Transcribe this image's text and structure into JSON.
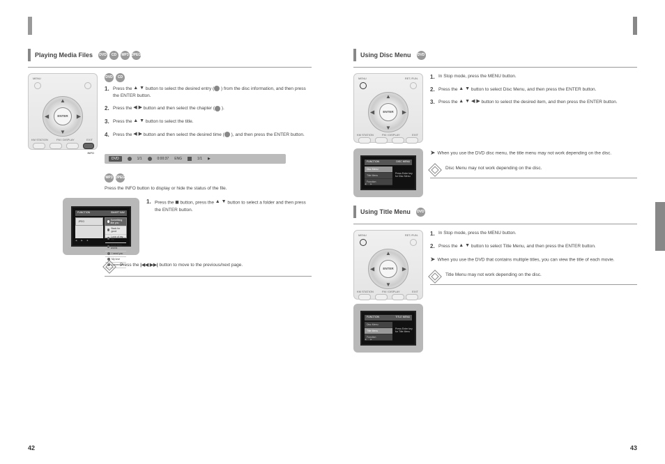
{
  "page_left_num": "42",
  "page_right_num": "43",
  "sec1": {
    "title": "Playing Media Files",
    "icon_row": [
      "DVD",
      "CD",
      "MP3",
      "JPEG"
    ],
    "sub1_icons": [
      "DVD",
      "CD"
    ],
    "sub1_steps": {
      "s1a": "Press the ",
      "s1b": " button to select the desired entry (",
      "s1c": ") from the disc information, and then press the ENTER button.",
      "s2a": "Press the ",
      "s2b": " button and then select the chapter (",
      "s2c": ").",
      "s3a": "Press the ",
      "s3b": " button to select the title.",
      "s4a": "Press the ",
      "s4b": " button and then select the desired time (",
      "s4c": "), and then press the ENTER button."
    },
    "info_bar": {
      "label_dvd": "DVD",
      "label_chapter": "1/1",
      "label_time": "0:00:37",
      "label_eng": "ENG",
      "label_dolby": "1/1"
    },
    "sub2_icons": [
      "MP3",
      "JPEG"
    ],
    "sub2_intro": "Press the INFO button to display or hide the status of the file.",
    "sub2_step1": "Press the ",
    "sub2_step1b": " button, press the ",
    "sub2_step1c": " button to select a folder and then press the ENTER button.",
    "screen1": {
      "top_l": "FUNCTION",
      "top_r": "SMART NAV",
      "side": "JPEG",
      "items": [
        "Something like you",
        "Back for good",
        "Love of my life",
        "More than words",
        "I need you",
        "My love",
        "Uptown girl"
      ]
    },
    "note1a": "Press the ",
    "note1b": " button to move to the previous/next page.",
    "skip_glyphs": "|◀◀ ▶▶|"
  },
  "sec2": {
    "title": "Using Disc Menu",
    "icons": [
      "DVD"
    ],
    "steps": {
      "s1": "In Stop mode, press the MENU button.",
      "s2a": "Press the ",
      "s2b": " button to select Disc Menu, and then press the ENTER button.",
      "s3a": "Press the ",
      "s3b": " button to select the desired item, and then press the ENTER button."
    },
    "tip": "When you use the DVD disc menu, the title menu may not work depending on the disc.",
    "note": "Disc Menu may not work depending on the disc.",
    "screen": {
      "top_l": "FUNCTION",
      "top_r": "DISC MENU",
      "panel": [
        "Disc Menu",
        "Title Menu",
        "Function"
      ],
      "msg1": "Press Enter key",
      "msg2": "for Disc Menu"
    }
  },
  "sec3": {
    "title": "Using Title Menu",
    "icons": [
      "DVD"
    ],
    "steps": {
      "s1": "In Stop mode, press the MENU button.",
      "s2a": "Press the ",
      "s2b": " button to select Title Menu, and then press the ENTER button."
    },
    "tip": "When you use the DVD that contains multiple titles, you can view the title of each movie.",
    "note": "Title Menu may not work depending on the disc.",
    "screen": {
      "top_l": "FUNCTION",
      "top_r": "TITLE MENU",
      "panel": [
        "Disc Menu",
        "Title Menu",
        "Function"
      ],
      "msg1": "Press Enter key",
      "msg2": "for Title Menu"
    }
  },
  "remote": {
    "enter": "ENTER",
    "menu": "MENU",
    "ret_fun": "RET./FUN.",
    "km_stn": "KM STATION",
    "fm_disp": "FM / DISPLAY",
    "exit": "EXIT",
    "info": "INFO"
  }
}
